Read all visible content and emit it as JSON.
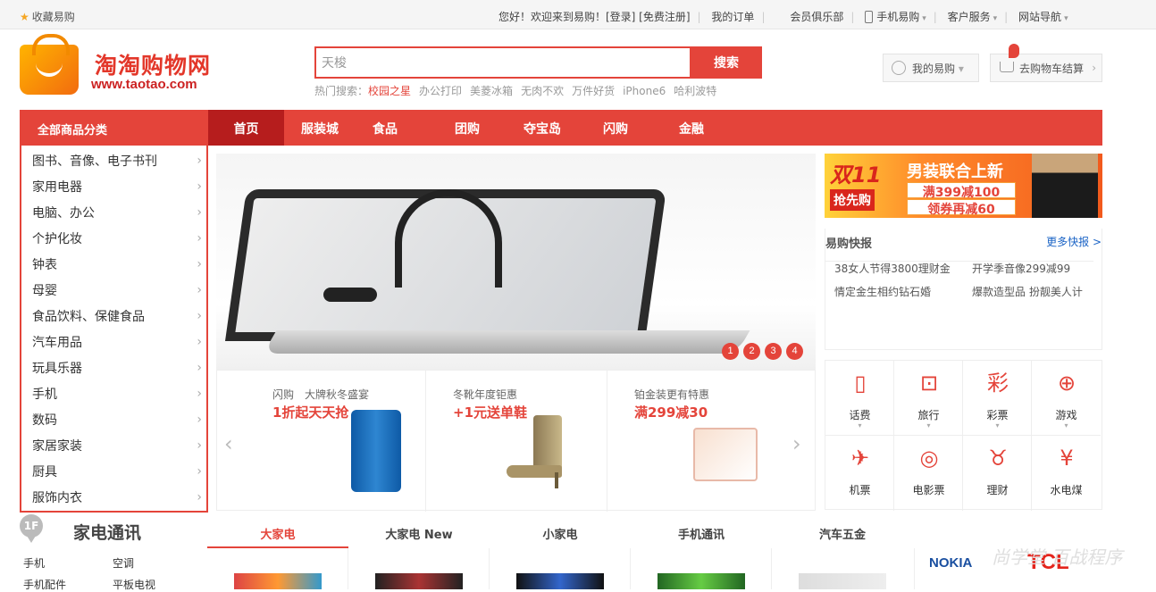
{
  "topbar": {
    "favorite": "收藏易购",
    "welcome": "您好！欢迎来到易购！[登录] [免费注册]",
    "my_orders": "我的订单",
    "member_club": "会员俱乐部",
    "mobile": "手机易购",
    "customer_service": "客户服务",
    "site_nav": "网站导航"
  },
  "logo": {
    "cn": "淘淘购物网",
    "url": "www.taotao.com"
  },
  "search": {
    "value": "天梭",
    "button": "搜索",
    "hot_label": "热门搜索：",
    "hot": [
      "校园之星",
      "办公打印",
      "美菱冰箱",
      "无肉不欢",
      "万件好货",
      "iPhone6",
      "哈利波特"
    ]
  },
  "user": {
    "my": "我的易购",
    "cart": "去购物车结算"
  },
  "nav": {
    "all": "全部商品分类",
    "items": [
      "首页",
      "服装城",
      "食品",
      "团购",
      "夺宝岛",
      "闪购",
      "金融"
    ]
  },
  "categories": [
    "图书、音像、电子书刊",
    "家用电器",
    "电脑、办公",
    "个护化妆",
    "钟表",
    "母婴",
    "食品饮料、保健食品",
    "汽车用品",
    "玩具乐器",
    "手机",
    "数码",
    "家居家装",
    "厨具",
    "服饰内衣"
  ],
  "banner": {
    "dots": [
      "1",
      "2",
      "3",
      "4"
    ]
  },
  "promos": [
    {
      "title": "闪购　大牌秋冬盛宴",
      "price": "1折起天天抢"
    },
    {
      "title": "冬靴年度钜惠",
      "price": "+1元送单鞋"
    },
    {
      "title": "铂金装更有特惠",
      "price": "满299减30"
    }
  ],
  "ad": {
    "d11": "双11",
    "qiang": "抢先购",
    "main": "男装联合上新",
    "l1": "满399减100",
    "l2": "领券再减60"
  },
  "news": {
    "title": "易购快报",
    "more": "更多快报 >",
    "items": [
      "38女人节得3800理财金",
      "开学季音像299减99",
      "情定金生相约钻石婚",
      "爆款造型品 扮靓美人计"
    ]
  },
  "services": [
    {
      "label": "话费",
      "icon": "phone-icon",
      "glyph": "▯"
    },
    {
      "label": "旅行",
      "icon": "luggage-icon",
      "glyph": "⊡"
    },
    {
      "label": "彩票",
      "icon": "lottery-icon",
      "glyph": "彩"
    },
    {
      "label": "游戏",
      "icon": "gamepad-icon",
      "glyph": "⊕"
    },
    {
      "label": "机票",
      "icon": "plane-icon",
      "glyph": "✈"
    },
    {
      "label": "电影票",
      "icon": "film-reel-icon",
      "glyph": "◎"
    },
    {
      "label": "理财",
      "icon": "piggy-bank-icon",
      "glyph": "♉"
    },
    {
      "label": "水电煤",
      "icon": "yen-coin-icon",
      "glyph": "¥"
    }
  ],
  "floor": {
    "badge": "1F",
    "title": "家电通讯",
    "links": [
      "手机",
      "空调",
      "手机配件",
      "平板电视"
    ],
    "tabs": [
      "大家电",
      "大家电 New",
      "小家电",
      "手机通讯",
      "汽车五金"
    ],
    "brands": [
      "NOKIA",
      "TCL"
    ]
  },
  "watermark": "尚学堂 百战程序",
  "colors": {
    "accent": "#e4443a",
    "nav_active": "#b61d1d",
    "link": "#1a63c5"
  }
}
